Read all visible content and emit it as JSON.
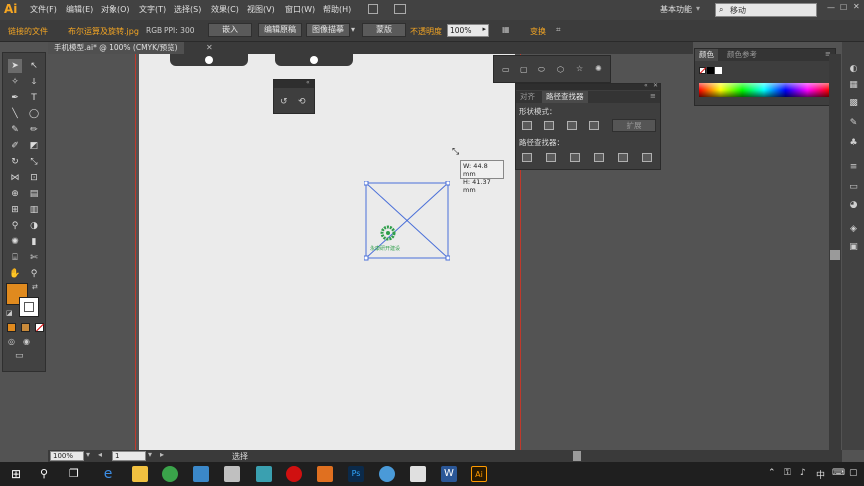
{
  "app": {
    "logo": "Ai"
  },
  "menu": [
    "文件(F)",
    "编辑(E)",
    "对象(O)",
    "文字(T)",
    "选择(S)",
    "效果(C)",
    "视图(V)",
    "窗口(W)",
    "帮助(H)"
  ],
  "workspace": {
    "label": "基本功能",
    "search_placeholder": "移动"
  },
  "control_bar": {
    "linked_file": "链接的文件",
    "file_name": "布尔运算及旋转.jpg",
    "color_mode": "RGB",
    "ppi": "PPI: 300",
    "embed": "嵌入",
    "edit_original": "编辑原稿",
    "image_trace": "图像描摹",
    "mask": "蒙版",
    "opacity_label": "不透明度",
    "opacity_value": "100%",
    "transform": "变换"
  },
  "document_tab": {
    "title": "手机模型.ai* @ 100% (CMYK/预览)"
  },
  "dimension_tooltip": {
    "w": "W: 44.8 mm",
    "h": "H: 41.37 mm"
  },
  "logo_text": "永康研开建设",
  "color_panel": {
    "tabs": [
      "颜色",
      "颜色参考"
    ]
  },
  "pathfinder_panel": {
    "tabs": [
      "对齐",
      "路径查找器"
    ],
    "shape_modes_label": "形状模式：",
    "expand_label": "扩展",
    "pathfinders_label": "路径查找器："
  },
  "status_bar": {
    "zoom": "100%",
    "page": "1",
    "tool": "选择"
  },
  "colors": {
    "fill": "#e08a1e",
    "accent": "#f5a623",
    "selection": "#4a6fd8",
    "guide": "#c0392b",
    "logo_green": "#2e9e4a"
  }
}
